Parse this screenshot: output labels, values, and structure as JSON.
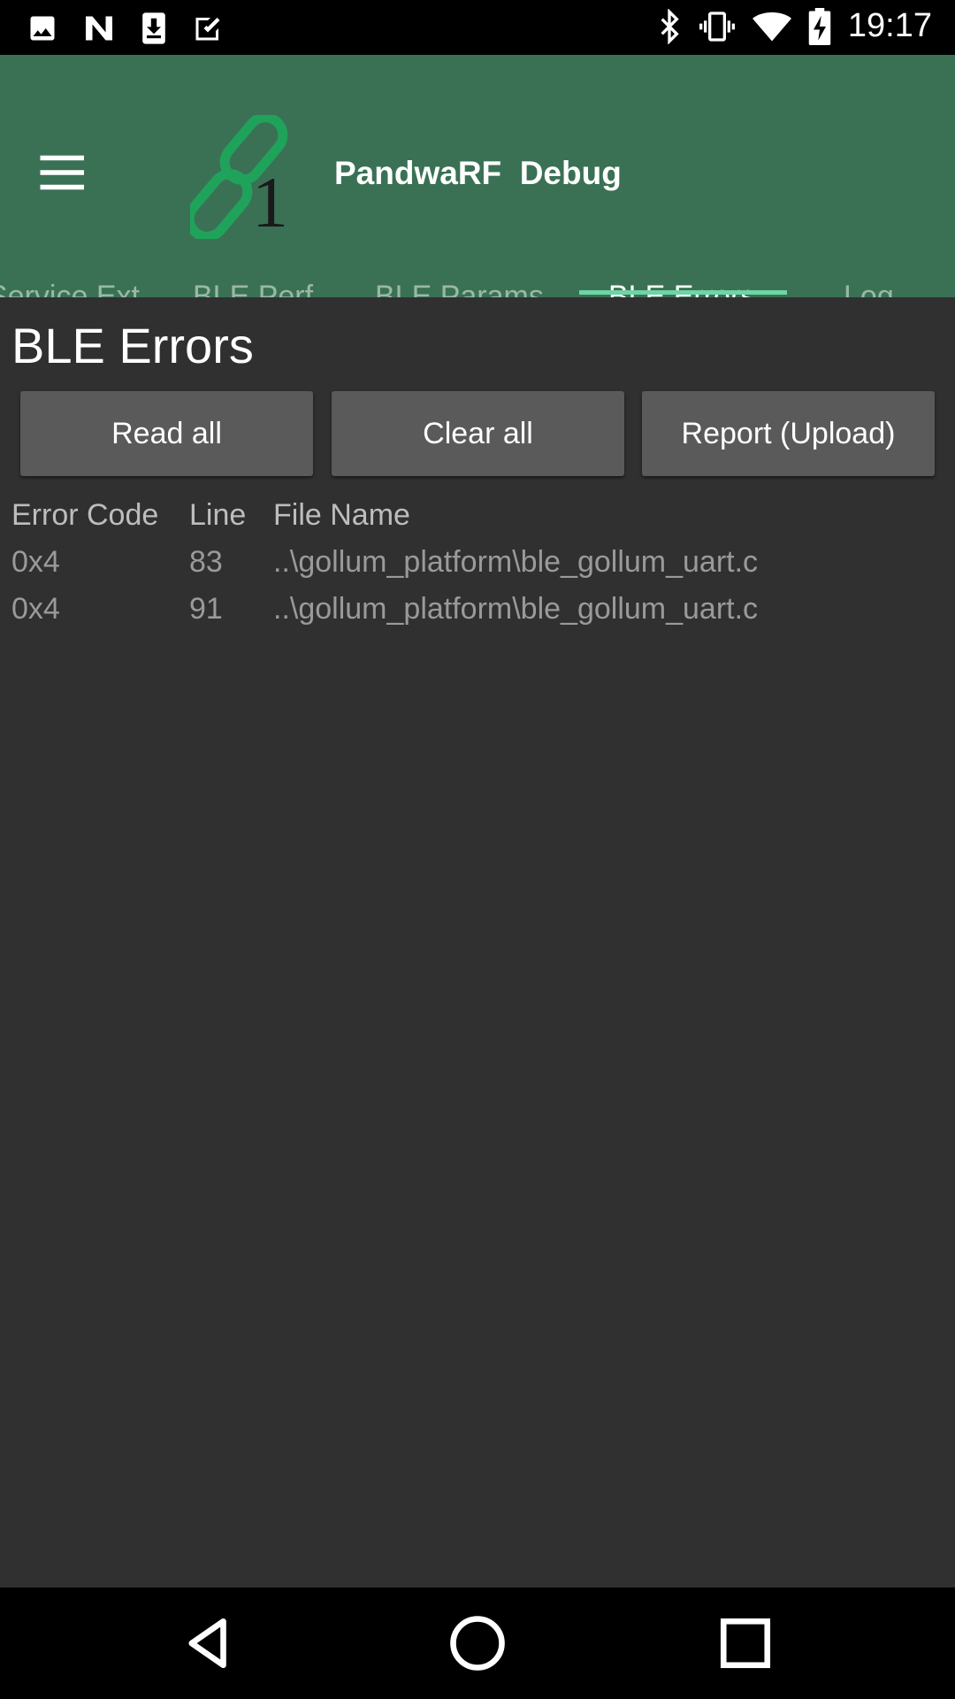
{
  "status_bar": {
    "time": "19:17",
    "left_icons": [
      "image-icon",
      "n-app-icon",
      "download-icon",
      "check-icon"
    ],
    "right_icons": [
      "bluetooth-icon",
      "vibrate-icon",
      "wifi-icon",
      "battery-charging-icon"
    ]
  },
  "app_bar": {
    "title": "PandwaRF  Debug",
    "tabs": [
      {
        "label": "Service Ext.",
        "active": false
      },
      {
        "label": "BLE Perf",
        "active": false
      },
      {
        "label": "BLE Params",
        "active": false
      },
      {
        "label": "BLE Errors",
        "active": true
      },
      {
        "label": "Log",
        "active": false
      }
    ]
  },
  "page": {
    "title": "BLE Errors",
    "buttons": {
      "read_all": "Read all",
      "clear_all": "Clear all",
      "report": "Report (Upload)"
    },
    "table": {
      "headers": [
        "Error Code",
        "Line",
        "File Name"
      ],
      "rows": [
        [
          "0x4",
          "83",
          "..\\gollum_platform\\ble_gollum_uart.c"
        ],
        [
          "0x4",
          "91",
          "..\\gollum_platform\\ble_gollum_uart.c"
        ]
      ]
    }
  },
  "colors": {
    "app_bar": "#3a7155",
    "accent": "#6fd4a6",
    "background": "#303030",
    "button": "#5a5a5a"
  }
}
